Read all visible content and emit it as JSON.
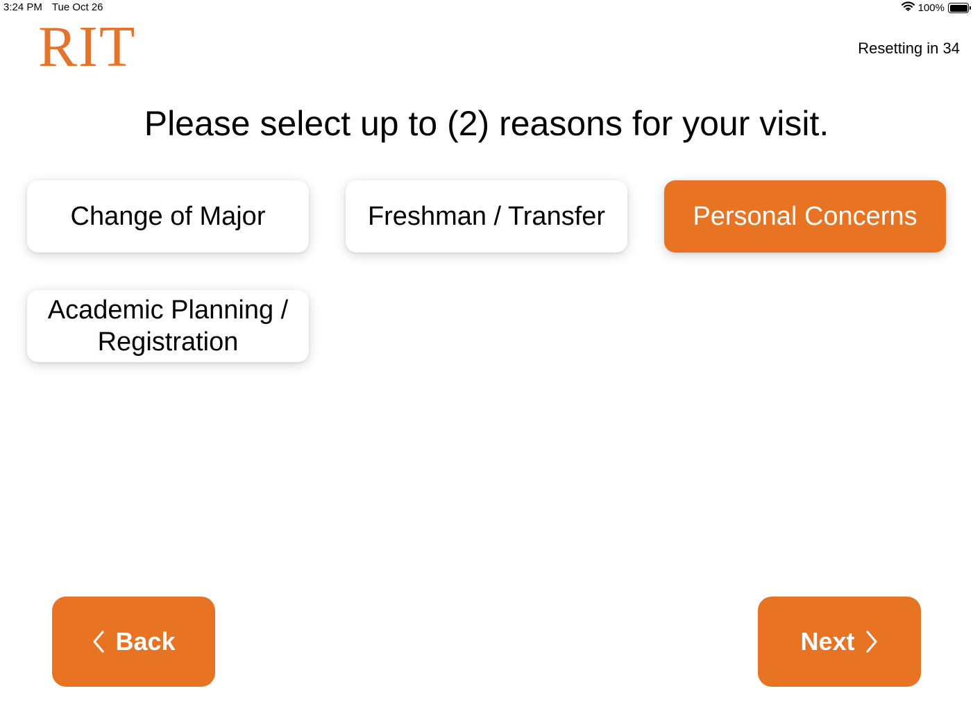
{
  "status_bar": {
    "time": "3:24 PM",
    "date": "Tue Oct 26",
    "battery_percent": "100%",
    "wifi_icon": "wifi-icon",
    "battery_icon": "battery-full-icon"
  },
  "header": {
    "logo_text": "RIT",
    "reset_text": "Resetting in 34"
  },
  "title": "Please select up to (2) reasons for your visit.",
  "reasons": [
    {
      "label": "Change of Major",
      "selected": false
    },
    {
      "label": "Freshman / Transfer",
      "selected": false
    },
    {
      "label": "Personal Concerns",
      "selected": true
    },
    {
      "label": "Academic Planning / Registration",
      "selected": false
    }
  ],
  "nav": {
    "back_label": "Back",
    "next_label": "Next",
    "back_icon": "chevron-left-icon",
    "next_icon": "chevron-right-icon"
  },
  "colors": {
    "accent": "#E87423",
    "logo": "#E4742B",
    "tile_bg": "#FFFFFF",
    "text": "#000000"
  }
}
